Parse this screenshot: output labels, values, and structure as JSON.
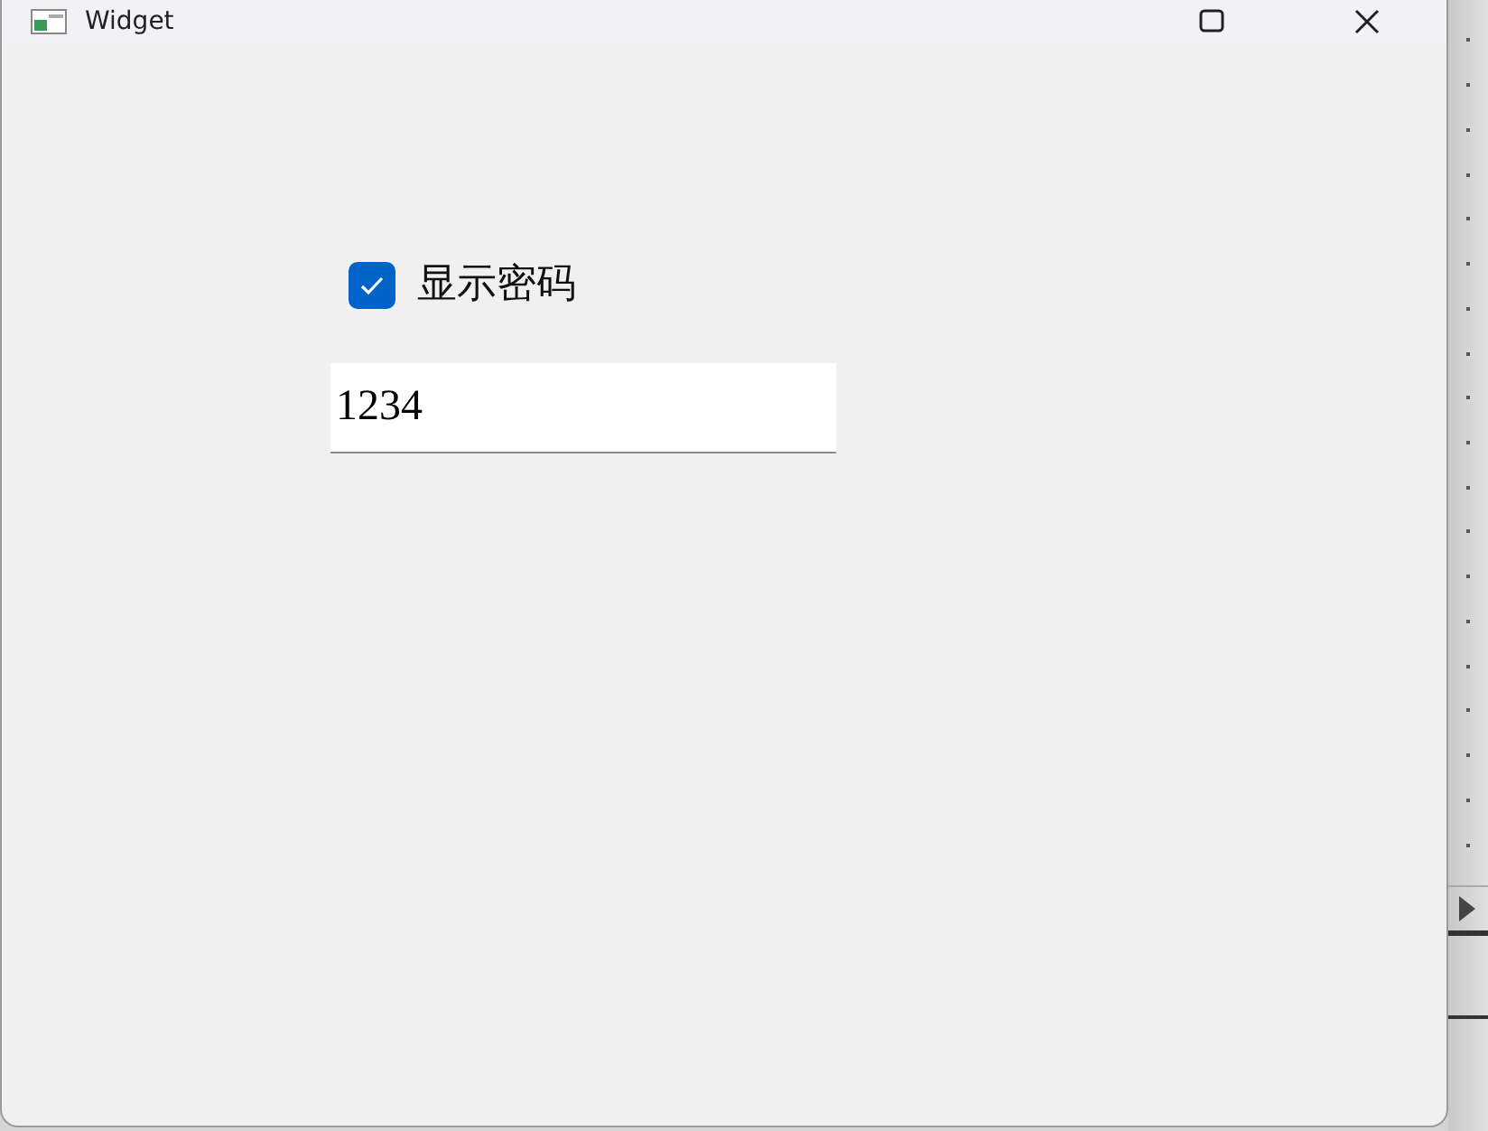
{
  "window": {
    "title": "Widget"
  },
  "show_password": {
    "label": "显示密码",
    "checked": true
  },
  "password_field": {
    "value": "1234"
  }
}
